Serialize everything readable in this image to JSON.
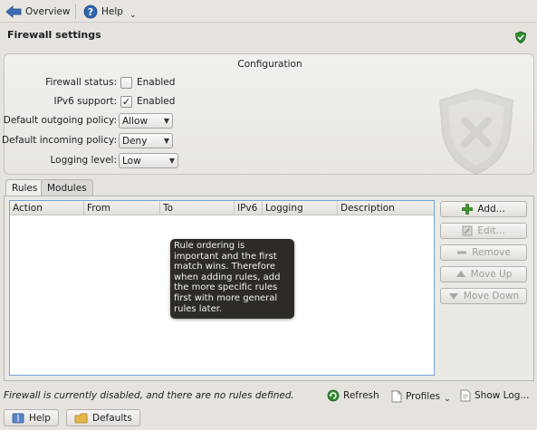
{
  "toolbar": {
    "overview_label": "Overview",
    "help_label": "Help"
  },
  "page_title": "Firewall settings",
  "configuration": {
    "title": "Configuration",
    "firewall_status": {
      "label": "Firewall status:",
      "checkbox_label": "Enabled",
      "checked": false
    },
    "ipv6_support": {
      "label": "IPv6 support:",
      "checkbox_label": "Enabled",
      "checked": true
    },
    "outgoing_policy": {
      "label": "Default outgoing policy:",
      "value": "Allow"
    },
    "incoming_policy": {
      "label": "Default incoming policy:",
      "value": "Deny"
    },
    "logging_level": {
      "label": "Logging level:",
      "value": "Low"
    }
  },
  "tabs": [
    {
      "label": "Rules",
      "active": true
    },
    {
      "label": "Modules",
      "active": false
    }
  ],
  "rules_table": {
    "columns": [
      "Action",
      "From",
      "To",
      "IPv6",
      "Logging",
      "Description"
    ],
    "rows": [],
    "tooltip": "Rule ordering is important and the first match wins. Therefore when adding rules, add the more specific rules first with more general rules later."
  },
  "side_buttons": {
    "add": "Add...",
    "edit": "Edit...",
    "remove": "Remove",
    "move_up": "Move Up",
    "move_down": "Move Down"
  },
  "status": {
    "message": "Firewall is currently disabled, and there are no rules defined.",
    "refresh": "Refresh",
    "profiles": "Profiles",
    "show_log": "Show Log..."
  },
  "bottom_buttons": {
    "help": "Help",
    "defaults": "Defaults"
  },
  "colors": {
    "accent_blue": "#6fa6d6",
    "shield_green": "#2e8b2e",
    "add_green": "#3a9a2a",
    "tooltip_bg": "#2e2b27"
  }
}
